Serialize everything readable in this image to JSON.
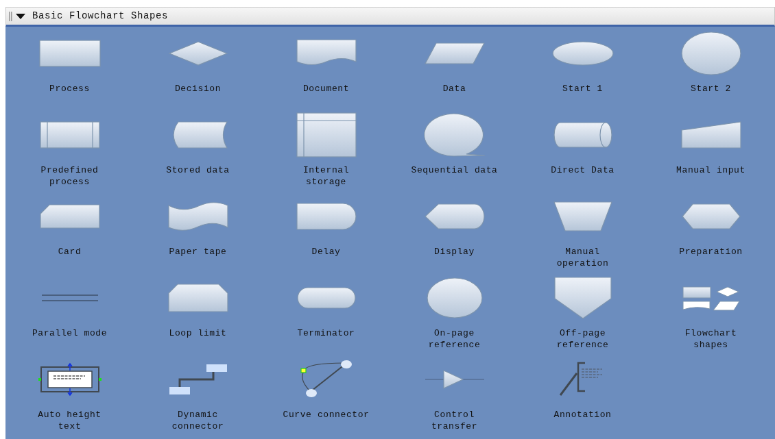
{
  "panel": {
    "title": "Basic Flowchart Shapes",
    "expanded": true
  },
  "shapes": [
    {
      "label": "Process",
      "kind": "process"
    },
    {
      "label": "Decision",
      "kind": "decision"
    },
    {
      "label": "Document",
      "kind": "document"
    },
    {
      "label": "Data",
      "kind": "data"
    },
    {
      "label": "Start 1",
      "kind": "start1"
    },
    {
      "label": "Start 2",
      "kind": "start2"
    },
    {
      "label": "Predefined process",
      "kind": "predefined"
    },
    {
      "label": "Stored data",
      "kind": "stored"
    },
    {
      "label": "Internal storage",
      "kind": "internal"
    },
    {
      "label": "Sequential data",
      "kind": "sequential"
    },
    {
      "label": "Direct Data",
      "kind": "direct"
    },
    {
      "label": "Manual input",
      "kind": "manualinput"
    },
    {
      "label": "Card",
      "kind": "card"
    },
    {
      "label": "Paper tape",
      "kind": "papertape"
    },
    {
      "label": "Delay",
      "kind": "delay"
    },
    {
      "label": "Display",
      "kind": "display"
    },
    {
      "label": "Manual operation",
      "kind": "manualop"
    },
    {
      "label": "Preparation",
      "kind": "preparation"
    },
    {
      "label": "Parallel mode",
      "kind": "parallel"
    },
    {
      "label": "Loop limit",
      "kind": "looplimit"
    },
    {
      "label": "Terminator",
      "kind": "terminator"
    },
    {
      "label": "On-page reference",
      "kind": "onpage"
    },
    {
      "label": "Off-page reference",
      "kind": "offpage"
    },
    {
      "label": "Flowchart shapes",
      "kind": "flowchartshapes"
    },
    {
      "label": "Auto height text",
      "kind": "autoheight"
    },
    {
      "label": "Dynamic connector",
      "kind": "dynamic"
    },
    {
      "label": "Curve connector",
      "kind": "curve"
    },
    {
      "label": "Control transfer",
      "kind": "control"
    },
    {
      "label": "Annotation",
      "kind": "annotation"
    }
  ]
}
